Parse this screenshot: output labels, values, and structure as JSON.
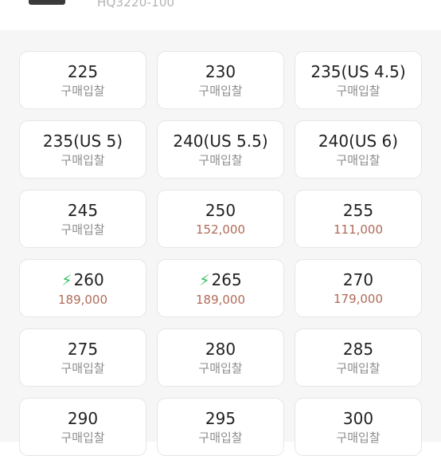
{
  "header": {
    "model_code": "HQ3220-100"
  },
  "sizes": [
    {
      "size": "225",
      "label": "구매입찰",
      "is_price": false,
      "fast": false
    },
    {
      "size": "230",
      "label": "구매입찰",
      "is_price": false,
      "fast": false
    },
    {
      "size": "235(US 4.5)",
      "label": "구매입찰",
      "is_price": false,
      "fast": false
    },
    {
      "size": "235(US 5)",
      "label": "구매입찰",
      "is_price": false,
      "fast": false
    },
    {
      "size": "240(US 5.5)",
      "label": "구매입찰",
      "is_price": false,
      "fast": false
    },
    {
      "size": "240(US 6)",
      "label": "구매입찰",
      "is_price": false,
      "fast": false
    },
    {
      "size": "245",
      "label": "구매입찰",
      "is_price": false,
      "fast": false
    },
    {
      "size": "250",
      "label": "152,000",
      "is_price": true,
      "fast": false
    },
    {
      "size": "255",
      "label": "111,000",
      "is_price": true,
      "fast": false
    },
    {
      "size": "260",
      "label": "189,000",
      "is_price": true,
      "fast": true
    },
    {
      "size": "265",
      "label": "189,000",
      "is_price": true,
      "fast": true
    },
    {
      "size": "270",
      "label": "179,000",
      "is_price": true,
      "fast": false
    },
    {
      "size": "275",
      "label": "구매입찰",
      "is_price": false,
      "fast": false
    },
    {
      "size": "280",
      "label": "구매입찰",
      "is_price": false,
      "fast": false
    },
    {
      "size": "285",
      "label": "구매입찰",
      "is_price": false,
      "fast": false
    },
    {
      "size": "290",
      "label": "구매입찰",
      "is_price": false,
      "fast": false
    },
    {
      "size": "295",
      "label": "구매입찰",
      "is_price": false,
      "fast": false
    },
    {
      "size": "300",
      "label": "구매입찰",
      "is_price": false,
      "fast": false
    }
  ],
  "icons": {
    "fast_delivery": "lightning-bolt-icon",
    "fast_delivery_color": "#2fbf5b"
  },
  "colors": {
    "price": "#b06a57",
    "bid_label": "#8c8c8c"
  }
}
